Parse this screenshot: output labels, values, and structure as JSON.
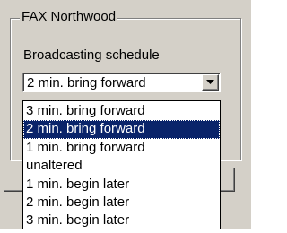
{
  "group": {
    "title": "FAX Northwood",
    "label": "Broadcasting schedule"
  },
  "combo": {
    "value": "2 min. bring forward",
    "button_icon": "chevron-down-icon"
  },
  "dropdown": {
    "selected_index": 1,
    "options": [
      "3 min. bring forward",
      "2 min. bring forward",
      "1 min. bring forward",
      "unaltered",
      "1 min. begin later",
      "2 min. begin later",
      "3 min. begin later"
    ]
  }
}
